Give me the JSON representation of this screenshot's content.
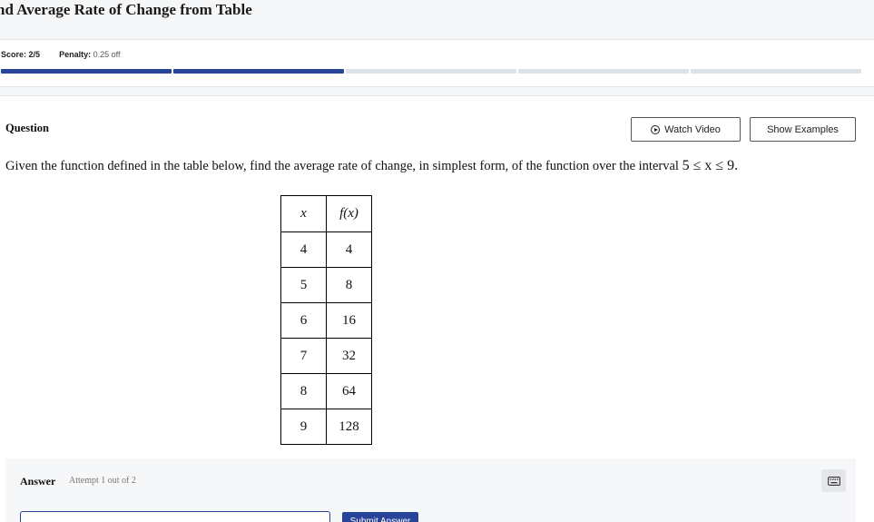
{
  "header": {
    "title": "nd Average Rate of Change from Table"
  },
  "status": {
    "score_label": "Score:",
    "score_value": "2/5",
    "penalty_label": "Penalty:",
    "penalty_value": "0.25 off",
    "progress": {
      "completed": 2,
      "total": 5
    }
  },
  "question": {
    "heading": "Question",
    "watch_video_label": "Watch Video",
    "show_examples_label": "Show Examples",
    "text": "Given the function defined in the table below, find the average rate of change, in simplest form, of the function over the interval",
    "interval": "5 ≤ x ≤ 9."
  },
  "table": {
    "headers": [
      "x",
      "f(x)"
    ],
    "rows": [
      [
        "4",
        "4"
      ],
      [
        "5",
        "8"
      ],
      [
        "6",
        "16"
      ],
      [
        "7",
        "32"
      ],
      [
        "8",
        "64"
      ],
      [
        "9",
        "128"
      ]
    ]
  },
  "answer": {
    "label": "Answer",
    "attempt_text": "Attempt 1 out of 2",
    "input_value": "",
    "submit_label": "Submit Answer",
    "keyboard_icon": "keyboard-icon"
  },
  "colors": {
    "accent": "#28439a",
    "track": "#dde1e8",
    "panel": "#f6f7f8"
  }
}
